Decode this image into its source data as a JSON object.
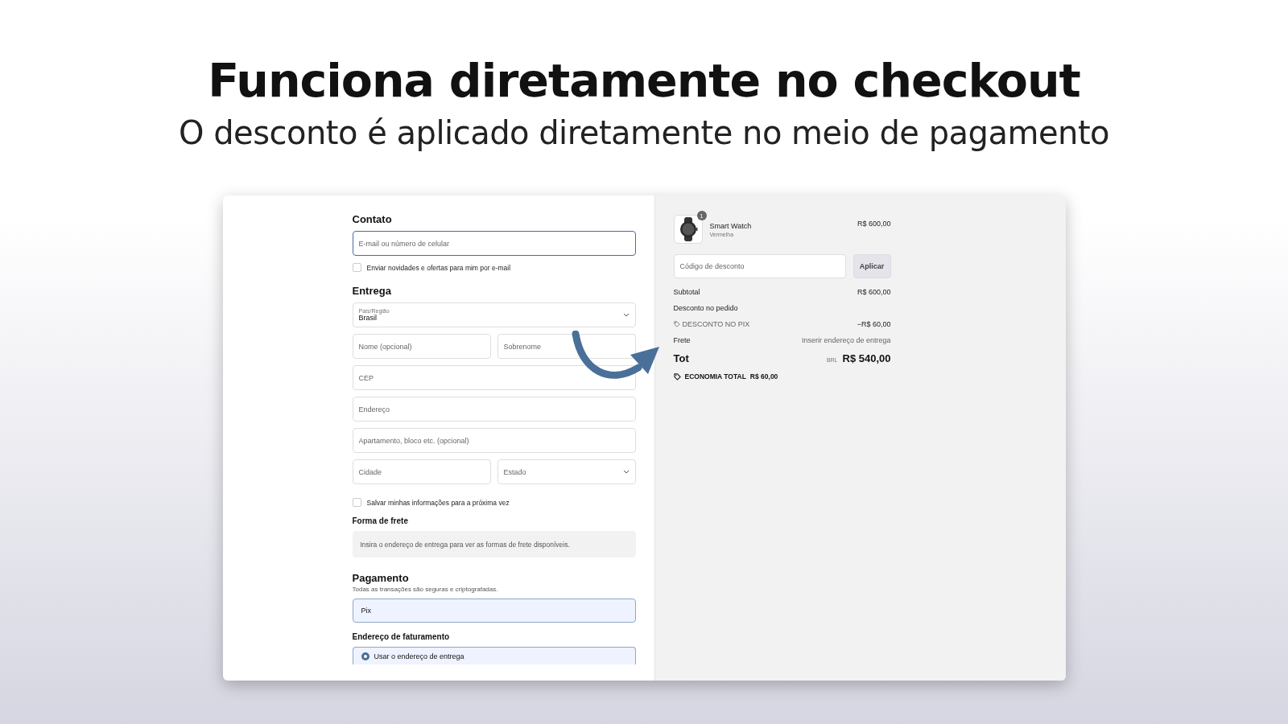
{
  "headline": "Funciona diretamente no checkout",
  "subheadline": "O desconto é aplicado diretamente no meio de pagamento",
  "checkout": {
    "contact": {
      "heading": "Contato",
      "email_field": {
        "placeholder": "E-mail ou número de celular",
        "focused": true
      },
      "newsletter": {
        "label": "Enviar novidades e ofertas para mim por e-mail",
        "checked": false
      }
    },
    "delivery": {
      "heading": "Entrega",
      "rows": [
        {
          "fields": [
            {
              "kind": "select",
              "label": "País/Região",
              "value": "Brasil"
            }
          ]
        },
        {
          "fields": [
            {
              "kind": "text",
              "placeholder": "Nome (opcional)"
            },
            {
              "kind": "text",
              "placeholder": "Sobrenome"
            }
          ]
        },
        {
          "fields": [
            {
              "kind": "text",
              "placeholder": "CEP"
            }
          ]
        },
        {
          "fields": [
            {
              "kind": "text",
              "placeholder": "Endereço"
            }
          ]
        },
        {
          "fields": [
            {
              "kind": "text",
              "placeholder": "Apartamento, bloco etc. (opcional)"
            }
          ]
        },
        {
          "fields": [
            {
              "kind": "text",
              "placeholder": "Cidade"
            },
            {
              "kind": "select",
              "placeholder": "Estado"
            }
          ]
        }
      ],
      "save_info": {
        "label": "Salvar minhas informações para a próxima vez",
        "checked": false
      }
    },
    "shipping": {
      "heading": "Forma de frete",
      "notice": "Insira o endereço de entrega para ver as formas de frete disponíveis."
    },
    "payment": {
      "heading": "Pagamento",
      "note": "Todas as transações são seguras e criptografadas.",
      "methods": [
        {
          "label": "Pix",
          "selected": true
        }
      ]
    },
    "billing": {
      "heading": "Endereço de faturamento",
      "options": [
        {
          "label": "Usar o endereço de entrega",
          "selected": true
        }
      ]
    }
  },
  "summary": {
    "item": {
      "name": "Smart Watch",
      "variant": "Vermelha",
      "quantity": "1",
      "price": "R$ 600,00"
    },
    "discount_field": {
      "placeholder": "Código de desconto"
    },
    "apply_button": "Aplicar",
    "subtotal": {
      "label": "Subtotal",
      "value": "R$ 600,00"
    },
    "order_discount": {
      "label": "Desconto no pedido",
      "code": "DESCONTO NO PIX",
      "value": "−R$ 60,00"
    },
    "shipping": {
      "label": "Frete",
      "value": "Inserir endereço de entrega"
    },
    "total": {
      "label": "Tot",
      "currency": "BRL",
      "value": "R$ 540,00"
    },
    "savings": {
      "label": "ECONOMIA TOTAL",
      "value": "R$ 60,00"
    }
  }
}
